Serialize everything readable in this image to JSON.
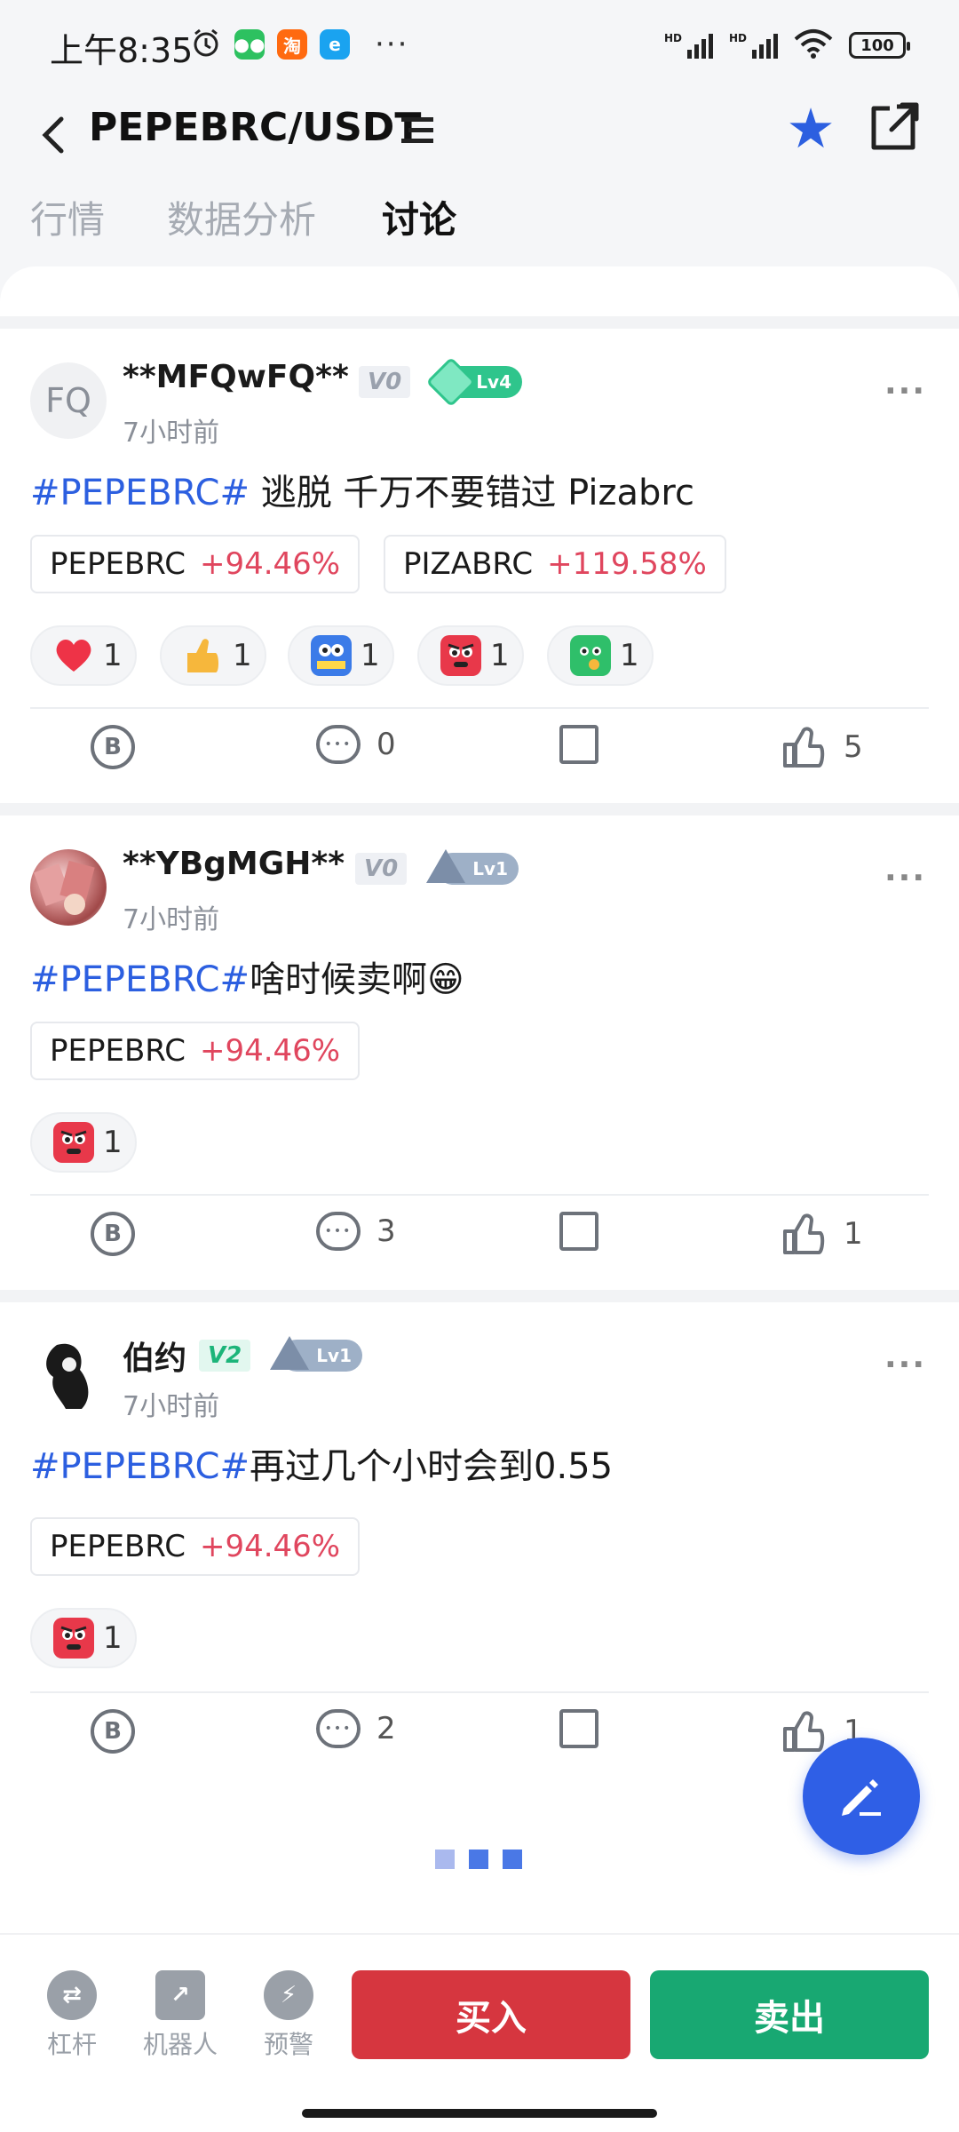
{
  "status_bar": {
    "time": "上午8:35",
    "battery": "100",
    "network_label": "HD",
    "app_icons": [
      "alarm-icon",
      "wechat-icon",
      "taobao-icon",
      "browser-icon"
    ],
    "app_badges": [
      "淘"
    ]
  },
  "header": {
    "title": "PEPEBRC/USDT",
    "favorited": true
  },
  "tabs": [
    {
      "label": "行情",
      "active": false
    },
    {
      "label": "数据分析",
      "active": false
    },
    {
      "label": "讨论",
      "active": true
    }
  ],
  "posts": [
    {
      "avatar_text": "FQ",
      "username": "**MFQwFQ**",
      "vip": "V0",
      "level": "Lv4",
      "time": "7小时前",
      "hashtag": "#PEPEBRC#",
      "text": " 逃脱 千万不要错过 Pizabrc",
      "coins": [
        {
          "name": "PEPEBRC",
          "change": "+94.46%"
        },
        {
          "name": "PIZABRC",
          "change": "+119.58%"
        }
      ],
      "reactions": [
        {
          "icon": "heart-icon",
          "count": "1"
        },
        {
          "icon": "thumbs-up-emoji-icon",
          "count": "1"
        },
        {
          "icon": "hodl-emoji-icon",
          "count": "1"
        },
        {
          "icon": "angry-emoji-icon",
          "count": "1"
        },
        {
          "icon": "thinking-emoji-icon",
          "count": "1"
        }
      ],
      "comments": "0",
      "likes": "5"
    },
    {
      "avatar_text": "",
      "username": "**YBgMGH**",
      "vip": "V0",
      "level": "Lv1",
      "time": "7小时前",
      "hashtag": "#PEPEBRC#",
      "text": "啥时候卖啊😁",
      "coins": [
        {
          "name": "PEPEBRC",
          "change": "+94.46%"
        }
      ],
      "reactions": [
        {
          "icon": "angry-emoji-icon",
          "count": "1"
        }
      ],
      "comments": "3",
      "likes": "1"
    },
    {
      "avatar_text": "",
      "username": "伯约",
      "vip": "V2",
      "level": "Lv1",
      "time": "7小时前",
      "hashtag": "#PEPEBRC#",
      "text": "再过几个小时会到0.55",
      "coins": [
        {
          "name": "PEPEBRC",
          "change": "+94.46%"
        }
      ],
      "reactions": [
        {
          "icon": "angry-emoji-icon",
          "count": "1"
        }
      ],
      "comments": "2",
      "likes": "1"
    }
  ],
  "bottom_bar": {
    "tools": [
      {
        "label": "杠杆",
        "icon": "leverage-icon"
      },
      {
        "label": "机器人",
        "icon": "robot-icon"
      },
      {
        "label": "预警",
        "icon": "alert-icon"
      }
    ],
    "buy_label": "买入",
    "sell_label": "卖出"
  },
  "colors": {
    "accent": "#2f5fe6",
    "up": "#e0465e",
    "buy": "#d6363f",
    "sell": "#18a872",
    "hashtag": "#2c5fe0"
  }
}
